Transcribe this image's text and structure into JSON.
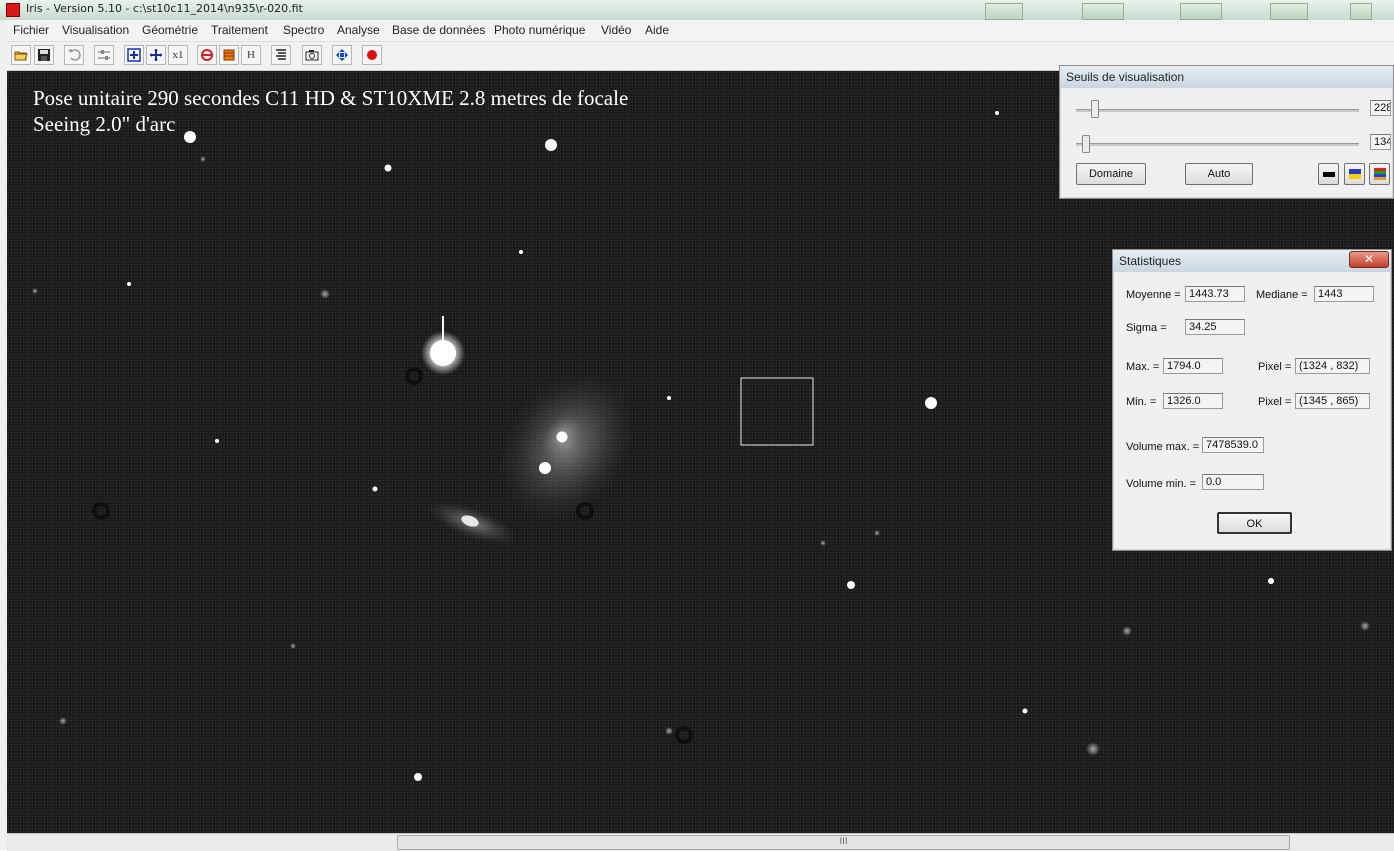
{
  "window": {
    "title": "Iris - Version 5.10 - c:\\st10c11_2014\\n935\\r-020.fit"
  },
  "menu": [
    "Fichier",
    "Visualisation",
    "Géométrie",
    "Traitement",
    "Spectro",
    "Analyse",
    "Base de données",
    "Photo numérique",
    "Vidéo",
    "Aide"
  ],
  "toolbar": {
    "buttons": [
      {
        "name": "open-icon"
      },
      {
        "name": "save-icon"
      },
      {
        "name": "undo-icon"
      },
      {
        "name": "settings-sliders-icon"
      },
      {
        "name": "zoom-in-icon"
      },
      {
        "name": "zoom-out-icon"
      },
      {
        "name": "zoom-x1-icon",
        "label": "x1"
      },
      {
        "name": "refresh-icon"
      },
      {
        "name": "palette-icon"
      },
      {
        "name": "histogram-icon",
        "label": "H"
      },
      {
        "name": "list-icon"
      },
      {
        "name": "camera-icon"
      },
      {
        "name": "move-icon"
      },
      {
        "name": "record-icon"
      }
    ]
  },
  "image": {
    "caption_line1": "Pose unitaire 290 secondes  C11 HD & ST10XME  2.8 metres de focale",
    "caption_line2": "Seeing 2.0\" d'arc"
  },
  "thresholds_dialog": {
    "title": "Seuils de visualisation",
    "high_value": "228",
    "low_value": "134",
    "domain_button": "Domaine",
    "auto_button": "Auto",
    "palette_colors": [
      "#000000",
      "#2a39c8",
      "#e0a020"
    ]
  },
  "stats_dialog": {
    "title": "Statistiques",
    "moyenne_label": "Moyenne =",
    "moyenne": "1443.73",
    "mediane_label": "Mediane =",
    "mediane": "1443",
    "sigma_label": "Sigma =",
    "sigma": "34.25",
    "max_label": "Max. =",
    "max": "1794.0",
    "pixel_label": "Pixel =",
    "max_pixel": "(1324 , 832)",
    "min_label": "Min. =",
    "min": "1326.0",
    "min_pixel": "(1345 , 865)",
    "volume_max_label": "Volume max. =",
    "volume_max": "7478539.0",
    "volume_min_label": "Volume min. =",
    "volume_min": "0.0",
    "ok_button": "OK"
  },
  "scrollbar": {
    "grip": "III"
  }
}
